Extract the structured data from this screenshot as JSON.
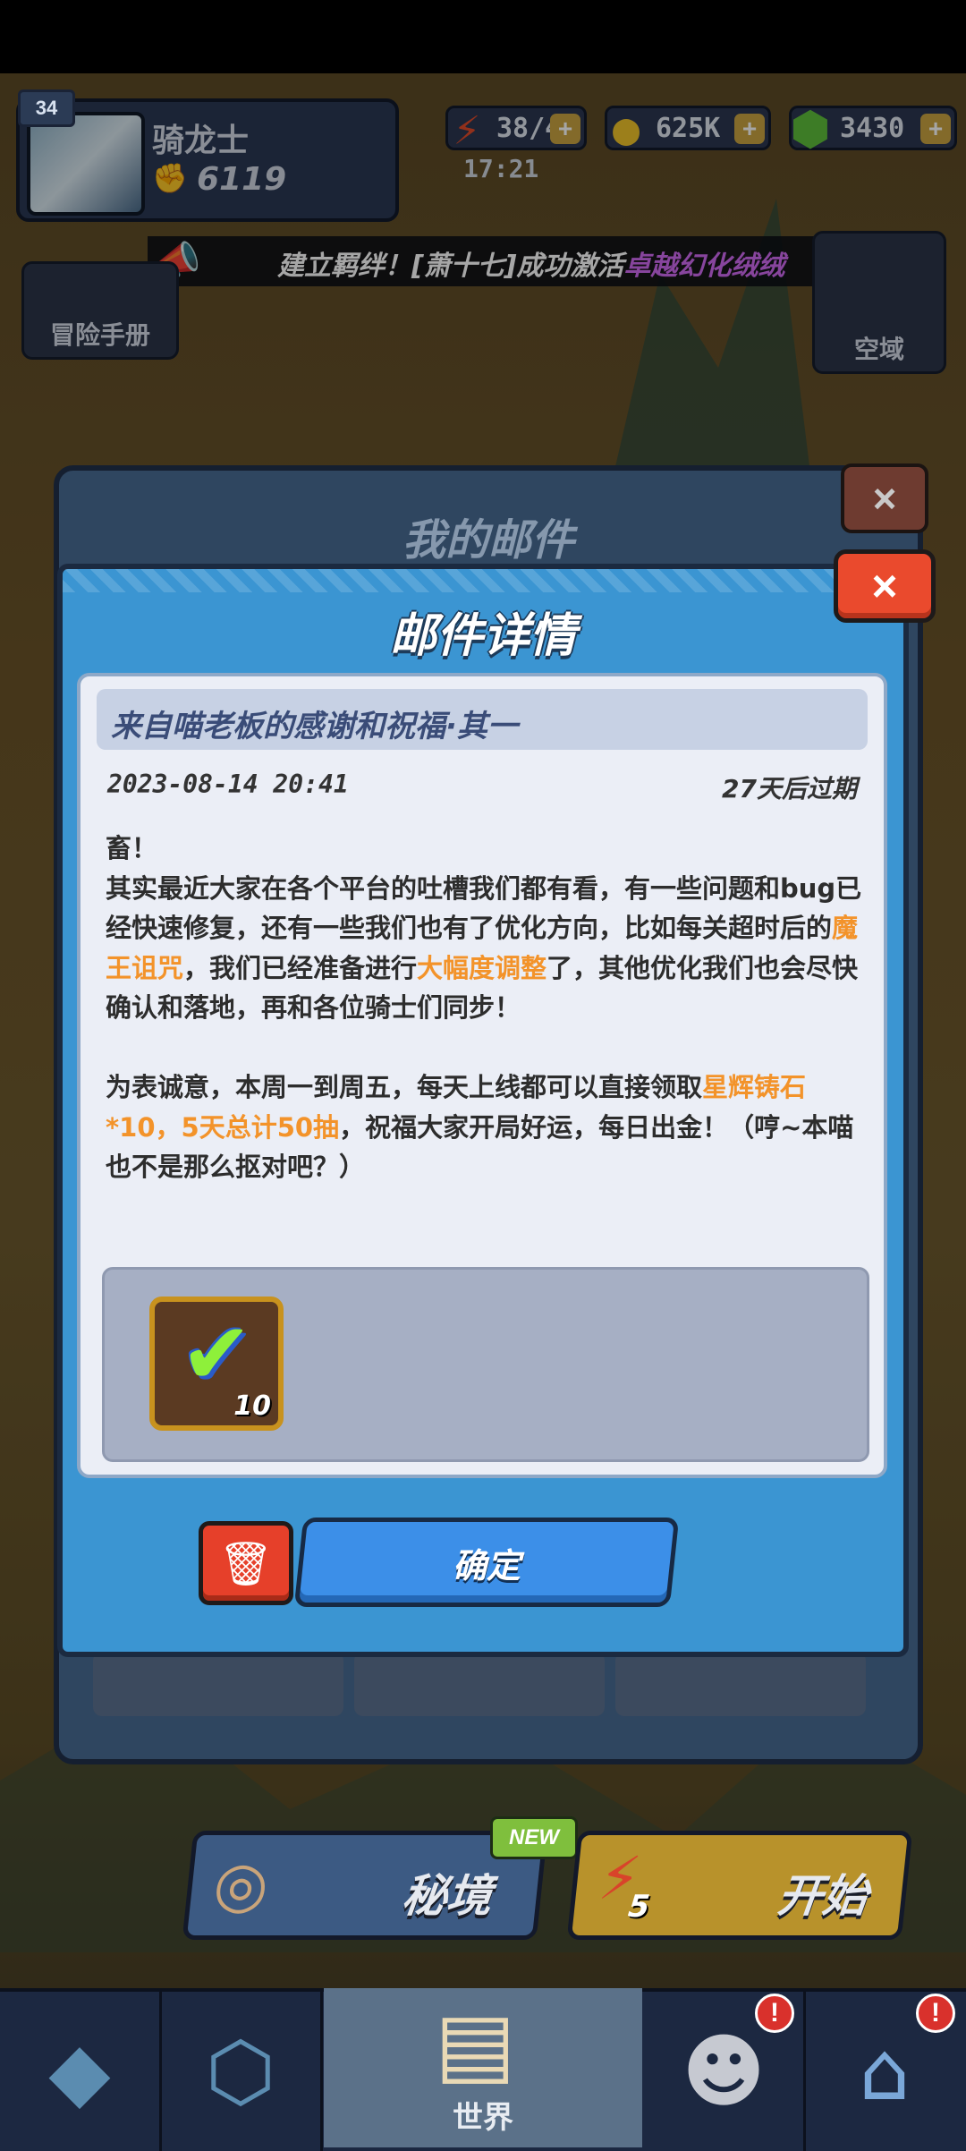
{
  "hud": {
    "level": "34",
    "player_name": "骑龙士",
    "power_icon": "fist-icon",
    "power": "6119",
    "energy": "38/44",
    "energy_timer": "17:21",
    "coins": "625K",
    "gems": "3430",
    "plus": "+"
  },
  "notice": {
    "prefix": "建立羁绊！[萧十七]成功激活",
    "highlight": "卓越幻化绒绒"
  },
  "side_buttons": {
    "adventure_manual": "冒险手册",
    "sky_domain": "空域"
  },
  "back_panel": {
    "title": "我的邮件",
    "close": "×"
  },
  "dialog": {
    "title": "邮件详情",
    "close": "×",
    "subject": "来自喵老板的感谢和祝福·其一",
    "date": "2023-08-14 20:41",
    "expire": "27天后过期",
    "body": {
      "greeting": "畜！",
      "p1_a": "其实最近大家在各个平台的吐槽我们都有看，有一些问题和bug已经快速修复，还有一些我们也有了优化方向，比如每关超时后的",
      "p1_hl1": "魔王诅咒",
      "p1_b": "，我们已经准备进行",
      "p1_hl2": "大幅度调整",
      "p1_c": "了，其他优化我们也会尽快确认和落地，再和各位骑士们同步！",
      "p2_a": "为表诚意，本周一到周五，每天上线都可以直接领取",
      "p2_hl1": "星辉铸石*10，5天总计50抽",
      "p2_b": "，祝福大家开局好运，每日出金！（哼~本喵也不是那么抠对吧？）"
    },
    "reward": {
      "icon": "star-forge-stone-icon",
      "quantity": "10"
    },
    "confirm_label": "确定",
    "delete_icon": "trash-icon"
  },
  "actions": {
    "secret_realm": "秘境",
    "new_badge": "NEW",
    "start": "开始",
    "start_cost": "5"
  },
  "nav": {
    "world_label": "世界",
    "alert": "!"
  },
  "colors": {
    "dialog_blue": "#3b95d2",
    "highlight_orange": "#f3932a",
    "notice_purple": "#d06af2",
    "close_red": "#ea4a2d"
  }
}
